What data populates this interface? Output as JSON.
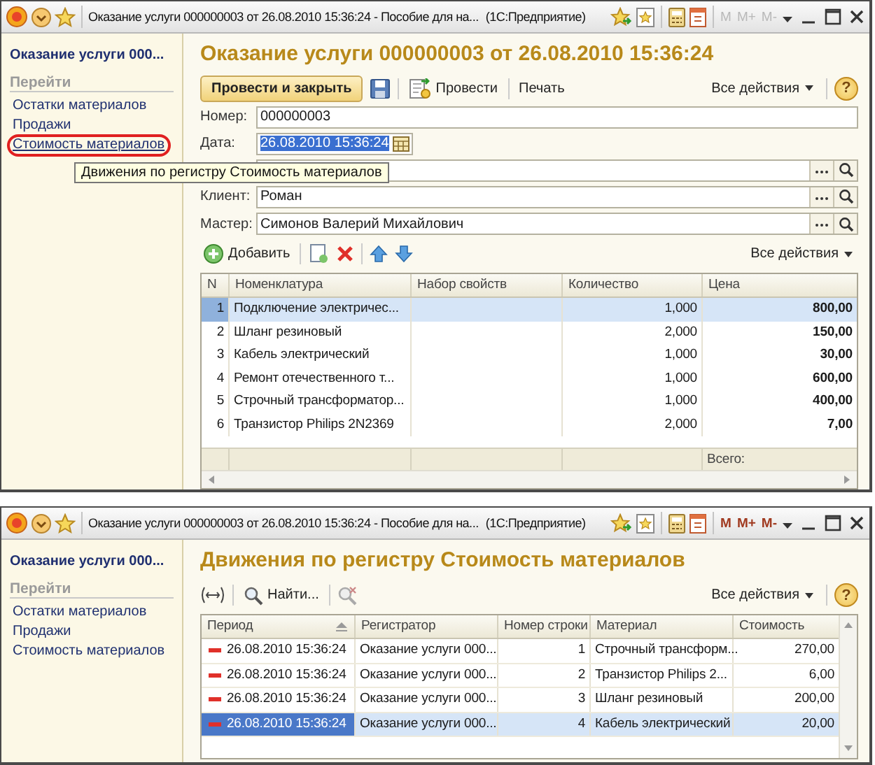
{
  "windows": [
    {
      "kind": "document",
      "title_bar": {
        "title": "Оказание услуги 000000003 от 26.08.2010 15:36:24 - Пособие для на...",
        "app": "(1С:Предприятие)",
        "memory_buttons": [
          {
            "label": "M",
            "disabled": true
          },
          {
            "label": "M+",
            "disabled": true
          },
          {
            "label": "M-",
            "disabled": true
          }
        ]
      },
      "sidebar": {
        "title": "Оказание услуги 000...",
        "section": "Перейти",
        "links": [
          {
            "label": "Остатки материалов",
            "hovered": false,
            "circled": false
          },
          {
            "label": "Продажи",
            "hovered": false,
            "circled": false
          },
          {
            "label": "Стоимость материалов",
            "hovered": true,
            "circled": true
          }
        ]
      },
      "heading": "Оказание услуги 000000003 от 26.08.2010 15:36:24",
      "toolbar": {
        "primary": "Провести и закрыть",
        "post": "Провести",
        "print": "Печать",
        "all_actions": "Все действия",
        "help": "?"
      },
      "fields": [
        {
          "kind": "text",
          "label": "Номер:",
          "value": "000000003"
        },
        {
          "kind": "date",
          "label": "Дата:",
          "value": "26.08.2010 15:36:24",
          "selected": true
        },
        {
          "kind": "ref"
        },
        {
          "kind": "ref",
          "label": "Клиент:",
          "value": "Роман"
        },
        {
          "kind": "ref",
          "label": "Мастер:",
          "value": "Симонов Валерий Михайлович"
        }
      ],
      "tooltip": "Движения по регистру Стоимость материалов",
      "table_toolbar": {
        "add": "Добавить",
        "all_actions": "Все действия"
      },
      "table": {
        "columns": [
          "N",
          "Номенклатура",
          "Набор свойств",
          "Количество",
          "Цена"
        ],
        "rows": [
          {
            "n": "1",
            "item": "Подключение электричес...",
            "qty": "1,000",
            "price": "800,00",
            "selected": true
          },
          {
            "n": "2",
            "item": "Шланг резиновый",
            "qty": "2,000",
            "price": "150,00",
            "selected": false
          },
          {
            "n": "3",
            "item": "Кабель электрический",
            "qty": "1,000",
            "price": "30,00",
            "selected": false
          },
          {
            "n": "4",
            "item": "Ремонт отечественного т...",
            "qty": "1,000",
            "price": "600,00",
            "selected": false
          },
          {
            "n": "5",
            "item": "Строчный трансформатор...",
            "qty": "1,000",
            "price": "400,00",
            "selected": false
          },
          {
            "n": "6",
            "item": "Транзистор Philips 2N2369",
            "qty": "2,000",
            "price": "7,00",
            "selected": false
          }
        ],
        "footer_label": "Всего:"
      }
    },
    {
      "kind": "register",
      "title_bar": {
        "title": "Оказание услуги 000000003 от 26.08.2010 15:36:24 - Пособие для на...",
        "app": "(1С:Предприятие)",
        "memory_buttons": [
          {
            "label": "M",
            "disabled": false
          },
          {
            "label": "M+",
            "disabled": false
          },
          {
            "label": "M-",
            "disabled": false
          }
        ]
      },
      "sidebar": {
        "title": "Оказание услуги 000...",
        "section": "Перейти",
        "links": [
          {
            "label": "Остатки материалов",
            "hovered": false,
            "circled": false
          },
          {
            "label": "Продажи",
            "hovered": false,
            "circled": false
          },
          {
            "label": "Стоимость материалов",
            "hovered": false,
            "circled": false
          }
        ]
      },
      "heading": "Движения по регистру Стоимость материалов",
      "toolbar": {
        "find": "Найти...",
        "all_actions": "Все действия",
        "help": "?"
      },
      "table": {
        "columns": [
          "Период",
          "Регистратор",
          "Номер строки",
          "Материал",
          "Стоимость"
        ],
        "rows": [
          {
            "period": "26.08.2010 15:36:24",
            "registrar": "Оказание услуги 000...",
            "line": "1",
            "material": "Строчный трансформ...",
            "cost": "270,00",
            "selected": false
          },
          {
            "period": "26.08.2010 15:36:24",
            "registrar": "Оказание услуги 000...",
            "line": "2",
            "material": "Транзистор Philips 2...",
            "cost": "6,00",
            "selected": false
          },
          {
            "period": "26.08.2010 15:36:24",
            "registrar": "Оказание услуги 000...",
            "line": "3",
            "material": "Шланг резиновый",
            "cost": "200,00",
            "selected": false
          },
          {
            "period": "26.08.2010 15:36:24",
            "registrar": "Оказание услуги 000...",
            "line": "4",
            "material": "Кабель электрический",
            "cost": "20,00",
            "selected": true
          }
        ]
      }
    }
  ]
}
